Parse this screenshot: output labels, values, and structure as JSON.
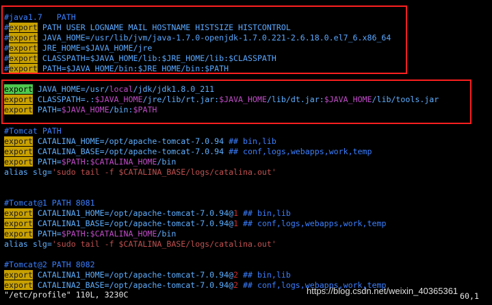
{
  "kw": "export",
  "block1": {
    "l0": "#java1.7   PATH",
    "l1_rest": " PATH USER LOGNAME MAIL HOSTNAME HISTSIZE HISTCONTROL",
    "l2_rest": " JAVA_HOME=/usr/lib/jvm/java-1.7.0-openjdk-1.7.0.221-2.6.18.0.el7_6.x86_64",
    "l3_rest": " JRE_HOME=$JAVA_HOME/jre",
    "l4_rest": " CLASSPATH=$JAVA_HOME/lib:$JRE_HOME/lib:$CLASSPATH",
    "l5_rest": " PATH=$JAVA_HOME/bin:$JRE_HOME/bin:$PATH"
  },
  "block2": {
    "l1_a": " JAVA_HOME=/usr/",
    "l1_b": "local",
    "l1_c": "/jdk/jdk1.8.0_211",
    "l2_a": " CLASSPATH=.:",
    "l2_b": "$JAVA_HOME",
    "l2_c": "/jre/lib/rt.jar:",
    "l2_d": "$JAVA_HOME",
    "l2_e": "/lib/dt.jar:",
    "l2_f": "$JAVA_HOME",
    "l2_g": "/lib/tools.jar",
    "l3_a": " PATH=",
    "l3_b": "$JAVA_HOME",
    "l3_c": "/bin:",
    "l3_d": "$PATH"
  },
  "tomcat": {
    "h": "#Tomcat PATH",
    "l1_a": " CATALINA_HOME=/opt/apache-tomcat-7.0.94 ",
    "l1_b": "## bin,lib",
    "l2_a": " CATALINA_BASE=/opt/apache-tomcat-7.0.94 ",
    "l2_b": "## conf,logs,webapps,work,temp",
    "l3_a": " PATH=",
    "l3_b": "$PATH",
    "l3_c": ":",
    "l3_d": "$CATALINA_HOME",
    "l3_e": "/bin",
    "alias_a": "alias slg=",
    "alias_b": "'sudo tail -f $CATALINA_BASE/logs/catalina.out'"
  },
  "tomcat1": {
    "h": "#Tomcat@1 PATH 8081",
    "l1_a": " CATALINA1_HOME=/opt/apache-tomcat-7.0.94@",
    "l1_b": "1",
    "l1_c": " ## bin,lib",
    "l2_a": " CATALINA1_BASE=/opt/apache-tomcat-7.0.94@",
    "l2_b": "1",
    "l2_c": " ## conf,logs,webapps,work,temp",
    "l3_a": " PATH=",
    "l3_b": "$PATH",
    "l3_c": ":",
    "l3_d": "$CATALINA_HOME",
    "l3_e": "/bin",
    "alias_a": "alias slg=",
    "alias_b": "'sudo tail -f $CATALINA_BASE/logs/catalina.out'"
  },
  "tomcat2": {
    "h": "#Tomcat@2 PATH 8082",
    "l1_a": " CATALINA1_HOME=/opt/apache-tomcat-7.0.94@",
    "l1_b": "2",
    "l1_c": " ## bin,lib",
    "l2_a": " CATALINA2_BASE=/opt/apache-tomcat-7.0.94@",
    "l2_b": "2",
    "l2_c": " ## conf,logs,webapps,work,temp"
  },
  "status": "\"/etc/profile\" 110L, 3230C",
  "position": "60,1",
  "watermark": "https://blog.csdn.net/weixin_40365361",
  "colors": {
    "highlight_box": "#ff2020",
    "keyword_bg": "#c8a000",
    "cursor_bg": "#4ec94e"
  }
}
